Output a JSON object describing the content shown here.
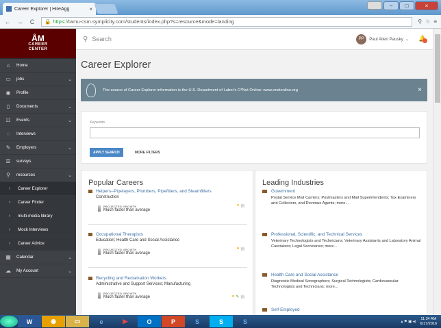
{
  "browser": {
    "tab_title": "Career Explorer | HireAgg",
    "tab_close": "×",
    "url_prefix": "https://",
    "url_rest": "tamu-csm.symplicity.com/students/index.php?s=resource&mode=landing"
  },
  "sidebar": {
    "logo_line1": "CAREER",
    "logo_line2": "CENTER",
    "items": [
      {
        "label": "Home",
        "icon": "home-icon",
        "glyph": "⌂",
        "chevron": false
      },
      {
        "label": "jobs",
        "icon": "briefcase-icon",
        "glyph": "▭",
        "chevron": true
      },
      {
        "label": "Profile",
        "icon": "user-icon",
        "glyph": "◉",
        "chevron": false
      },
      {
        "label": "Documents",
        "icon": "documents-icon",
        "glyph": "▯",
        "chevron": true
      },
      {
        "label": "Events",
        "icon": "events-icon",
        "glyph": "☷",
        "chevron": true
      },
      {
        "label": "Interviews",
        "icon": "interviews-icon",
        "glyph": "◌",
        "chevron": false
      },
      {
        "label": "Employers",
        "icon": "employers-icon",
        "glyph": "✎",
        "chevron": true
      },
      {
        "label": "surveys",
        "icon": "surveys-icon",
        "glyph": "☰",
        "chevron": false
      },
      {
        "label": "resources",
        "icon": "resources-icon",
        "glyph": "⚲",
        "chevron": true
      },
      {
        "label": "Career Explorer",
        "icon": "chevron-right-icon",
        "glyph": "›",
        "chevron": false,
        "sub": true,
        "active": true
      },
      {
        "label": "Career Finder",
        "icon": "chevron-right-icon",
        "glyph": "›",
        "chevron": false,
        "sub": true
      },
      {
        "label": "multi-media library",
        "icon": "chevron-right-icon",
        "glyph": "›",
        "chevron": false,
        "sub": true
      },
      {
        "label": "Mock Interviews",
        "icon": "chevron-right-icon",
        "glyph": "›",
        "chevron": false,
        "sub": true
      },
      {
        "label": "Career Advice",
        "icon": "chevron-right-icon",
        "glyph": "›",
        "chevron": false,
        "sub": true
      },
      {
        "label": "Calendar",
        "icon": "calendar-icon",
        "glyph": "▦",
        "chevron": true
      },
      {
        "label": "My Account",
        "icon": "account-icon",
        "glyph": "☁",
        "chevron": true
      }
    ]
  },
  "topbar": {
    "search_placeholder": "Search",
    "avatar_initials": "PP",
    "user_name": "Paul Allen Pausky"
  },
  "page": {
    "title": "Career Explorer",
    "info_message": "The source of Career Explorer information is the U.S. Department of Labor's O*Net Online: www.onetonline.org",
    "keywords_label": "Keywords",
    "apply_button": "APPLY SEARCH",
    "more_filters": "MORE FILTERS"
  },
  "popular": {
    "heading": "Popular Careers",
    "growth_label": "PROJECTED GROWTH",
    "items": [
      {
        "title": "Helpers--Pipelayers, Plumbers, Pipefitters, and Steamfitters",
        "category": "Construction",
        "growth": "Much faster than average"
      },
      {
        "title": "Occupational Therapists",
        "category": "Education; Health Care and Social Assistance",
        "growth": "Much faster than average"
      },
      {
        "title": "Recycling and Reclamation Workers",
        "category": "Administrative and Support Services; Manufacturing",
        "growth": "Much faster than average"
      }
    ]
  },
  "industries": {
    "heading": "Leading Industries",
    "items": [
      {
        "title": "Government",
        "desc": "Postal Service Mail Carriers; Postmasters and Mail Superintendents; Tax Examiners and Collectors, and Revenue Agents; more..."
      },
      {
        "title": "Professional, Scientific, and Technical Services",
        "desc": "Veterinary Technologists and Technicians; Veterinary Assistants and Laboratory Animal Caretakers; Legal Secretaries; more..."
      },
      {
        "title": "Health Care and Social Assistance",
        "desc": "Diagnostic Medical Sonographers; Surgical Technologists; Cardiovascular Technologists and Technicians; more..."
      },
      {
        "title": "Self-Employed",
        "desc": ""
      }
    ]
  },
  "taskbar": {
    "time": "11:34 AM",
    "date": "6/17/2016"
  }
}
